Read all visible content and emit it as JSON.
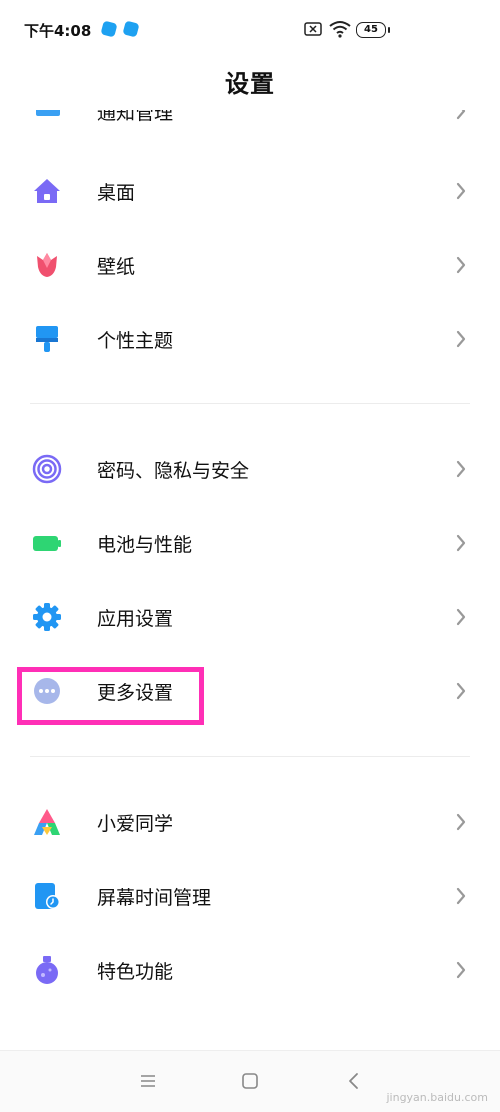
{
  "status_bar": {
    "time": "下午4:08",
    "battery": "45"
  },
  "header": {
    "title": "设置"
  },
  "partial_item": {
    "label": "通知管理"
  },
  "group1": [
    {
      "label": "桌面",
      "icon": "home-icon"
    },
    {
      "label": "壁纸",
      "icon": "tulip-icon"
    },
    {
      "label": "个性主题",
      "icon": "brush-icon"
    }
  ],
  "group2": [
    {
      "label": "密码、隐私与安全",
      "icon": "fingerprint-icon"
    },
    {
      "label": "电池与性能",
      "icon": "battery-icon"
    },
    {
      "label": "应用设置",
      "icon": "gear-icon"
    },
    {
      "label": "更多设置",
      "icon": "more-dots-icon"
    }
  ],
  "group3": [
    {
      "label": "小爱同学",
      "icon": "xiaoai-icon"
    },
    {
      "label": "屏幕时间管理",
      "icon": "screen-time-icon"
    },
    {
      "label": "特色功能",
      "icon": "flask-icon"
    }
  ],
  "watermark": {
    "text": "jingyan.baidu.com"
  },
  "colors": {
    "highlight": "#ff2fb6",
    "accent_blue": "#3aa0f3"
  }
}
